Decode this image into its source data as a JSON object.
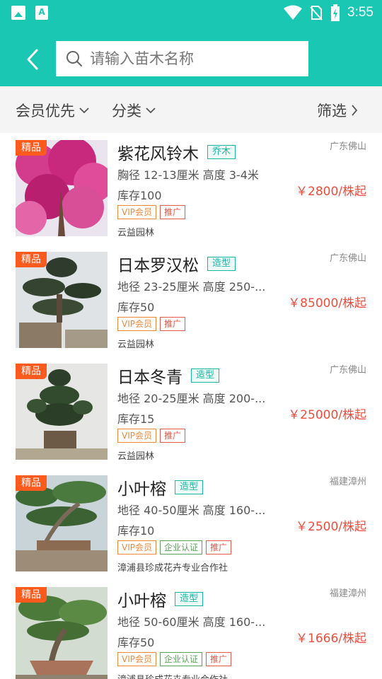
{
  "statusbar": {
    "time": "3:55",
    "notif_icons": [
      "image-icon",
      "a-letter-icon"
    ],
    "status_icons": [
      "wifi-icon",
      "no-sim-icon",
      "battery-icon"
    ]
  },
  "header": {
    "search_placeholder": "请输入苗木名称",
    "back_icon": "chevron-left-icon",
    "search_icon": "search-icon"
  },
  "filters": {
    "member_priority": "会员优先",
    "category": "分类",
    "filter": "筛选"
  },
  "colors": {
    "accent": "#19c7b3",
    "price": "#f04c3c",
    "badge": "#fd5a1e"
  },
  "items": [
    {
      "badge": "精品",
      "title": "紫花风铃木",
      "category": "乔木",
      "spec": "胸径 12-13厘米 高度 3-4米",
      "stock": "库存100",
      "tags": [
        "VIP会员",
        "推广"
      ],
      "seller": "云益园林",
      "location": "广东佛山",
      "price": "￥2800/株起"
    },
    {
      "badge": "精品",
      "title": "日本罗汉松",
      "category": "造型",
      "spec": "地径 23-25厘米 高度 250-...",
      "stock": "库存50",
      "tags": [
        "VIP会员",
        "推广"
      ],
      "seller": "云益园林",
      "location": "广东佛山",
      "price": "￥85000/株起"
    },
    {
      "badge": "精品",
      "title": "日本冬青",
      "category": "造型",
      "spec": "地径 20-25厘米 高度 200-...",
      "stock": "库存15",
      "tags": [
        "VIP会员",
        "推广"
      ],
      "seller": "云益园林",
      "location": "广东佛山",
      "price": "￥25000/株起"
    },
    {
      "badge": "精品",
      "title": "小叶榕",
      "category": "造型",
      "spec": "地径 40-50厘米 高度 160-...",
      "stock": "库存10",
      "tags": [
        "VIP会员",
        "企业认证",
        "推广"
      ],
      "seller": "漳浦县珍成花卉专业合作社",
      "location": "福建漳州",
      "price": "￥2500/株起"
    },
    {
      "badge": "精品",
      "title": "小叶榕",
      "category": "造型",
      "spec": "地径 50-60厘米 高度 160-...",
      "stock": "库存50",
      "tags": [
        "VIP会员",
        "企业认证",
        "推广"
      ],
      "seller": "漳浦县珍成花卉专业合作社",
      "location": "福建漳州",
      "price": "￥1666/株起"
    }
  ]
}
